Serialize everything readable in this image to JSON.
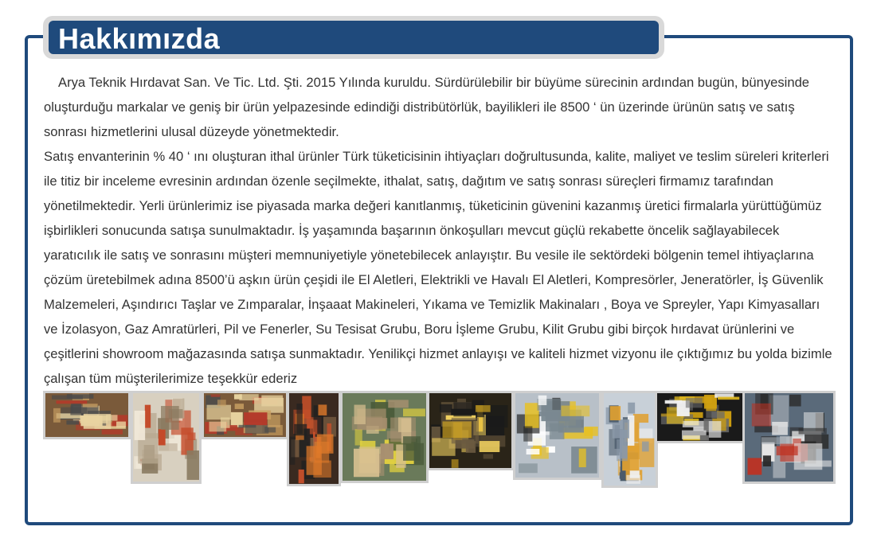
{
  "header": {
    "title": "Hakkımızda"
  },
  "content": {
    "paragraph1": "Arya Teknik Hırdavat San. Ve Tic. Ltd. Şti. 2015 Yılında kuruldu. Sürdürülebilir bir büyüme sürecinin ardından bugün, bünyesinde oluşturduğu markalar ve geniş bir ürün yelpazesinde edindiği distribütörlük, bayilikleri ile 8500 ‘ ün üzerinde ürünün satış ve satış sonrası hizmetlerini ulusal düzeyde yönetmektedir.",
    "paragraph2": "Satış envanterinin % 40 ‘ ını oluşturan ithal ürünler Türk tüketicisinin ihtiyaçları doğrultusunda, kalite, maliyet ve teslim süreleri kriterleri ile titiz bir inceleme evresinin ardından özenle seçilmekte, ithalat, satış, dağıtım ve satış sonrası süreçleri firmamız tarafından yönetilmektedir. Yerli ürünlerimiz ise piyasada marka değeri kanıtlanmış, tüketicinin güvenini kazanmış üretici firmalarla yürüttüğümüz işbirlikleri sonucunda satışa sunulmaktadır. İş yaşamında başarının önkoşulları mevcut güçlü rekabette öncelik sağlayabilecek yaratıcılık ile satış ve sonrasını müşteri memnuniyetiyle yönetebilecek anlayıştır. Bu vesile ile sektördeki bölgenin temel ihtiyaçlarına çözüm üretebilmek adına 8500’ü aşkın ürün çeşidi ile El Aletleri, Elektrikli ve Havalı El Aletleri, Kompresörler, Jeneratörler, İş Güvenlik Malzemeleri, Aşındırıcı Taşlar ve Zımparalar, İnşaaat Makineleri, Yıkama ve Temizlik Makinaları , Boya ve Spreyler, Yapı Kimyasalları ve İzolasyon, Gaz Amratürleri, Pil ve Fenerler, Su Tesisat Grubu, Boru İşleme Grubu, Kilit Grubu gibi birçok hırdavat ürünlerini ve çeşitlerini showroom mağazasında satışa sunmaktadır. Yenilikçi hizmet anlayışı ve kaliteli hizmet vizyonu ile çıktığımız bu yolda bizimle çalışan tüm müşterilerimize teşekkür ederiz"
  },
  "gallery": {
    "photos": [
      {
        "name": "store-shelves-photo-1",
        "palette": [
          "#7a5a3a",
          "#c9a063",
          "#e8d3a0",
          "#b33a2a",
          "#4a4a4a"
        ]
      },
      {
        "name": "store-interior-photo",
        "palette": [
          "#d8d0c0",
          "#b8a890",
          "#c44a2a",
          "#8a7a60",
          "#f0e8d8"
        ]
      },
      {
        "name": "store-shelves-photo-2",
        "palette": [
          "#7a5a3a",
          "#c9a063",
          "#e8d3a0",
          "#b33a2a",
          "#4a4a4a"
        ]
      },
      {
        "name": "tool-rack-photo",
        "palette": [
          "#3a2a20",
          "#c8502a",
          "#e07a2a",
          "#8a6a4a",
          "#202020"
        ]
      },
      {
        "name": "chainsaw-tree-photo",
        "palette": [
          "#6a7a5a",
          "#4a5a3a",
          "#a89070",
          "#d8c090",
          "#e0d040"
        ]
      },
      {
        "name": "dewalt-drill-set-photo",
        "palette": [
          "#2a2418",
          "#e0b020",
          "#1a1a1a",
          "#6a5a40",
          "#f0d060"
        ]
      },
      {
        "name": "dewalt-impact-drivers-photo",
        "palette": [
          "#b8c0c8",
          "#e8c020",
          "#1a1a1a",
          "#ffffff",
          "#7a8890"
        ]
      },
      {
        "name": "showroom-aisle-photo",
        "palette": [
          "#c8d0d8",
          "#8a98a8",
          "#f0f0f0",
          "#4a5a6a",
          "#e0a030"
        ]
      },
      {
        "name": "dewalt-display-wall-photo",
        "palette": [
          "#1a1a1a",
          "#e8c020",
          "#f0f0f0",
          "#6a6a6a",
          "#d0a010"
        ]
      },
      {
        "name": "power-tools-display-photo",
        "palette": [
          "#5a6a7a",
          "#c03020",
          "#e8e8e8",
          "#2a2a2a",
          "#a0a8b0"
        ]
      }
    ]
  }
}
